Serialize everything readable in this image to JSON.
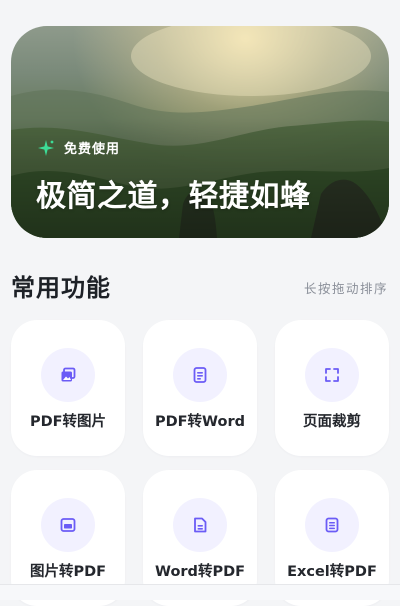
{
  "banner": {
    "badge": "免费使用",
    "title": "极简之道，轻捷如蜂"
  },
  "section": {
    "title": "常用功能",
    "hint": "长按拖动排序"
  },
  "features": [
    {
      "label": "PDF转图片",
      "icon": "images-icon"
    },
    {
      "label": "PDF转Word",
      "icon": "document-icon"
    },
    {
      "label": "页面裁剪",
      "icon": "crop-frame-icon"
    },
    {
      "label": "图片转PDF",
      "icon": "image-icon"
    },
    {
      "label": "Word转PDF",
      "icon": "word-document-icon"
    },
    {
      "label": "Excel转PDF",
      "icon": "excel-document-icon"
    }
  ],
  "colors": {
    "accent": "#6b5cf6",
    "accent_soft": "#f2f1ff",
    "badge_icon": "#3ddc97",
    "page_bg": "#f4f5f7",
    "card_bg": "#ffffff",
    "title_text": "#1d2127",
    "hint_text": "#8a8f99"
  }
}
